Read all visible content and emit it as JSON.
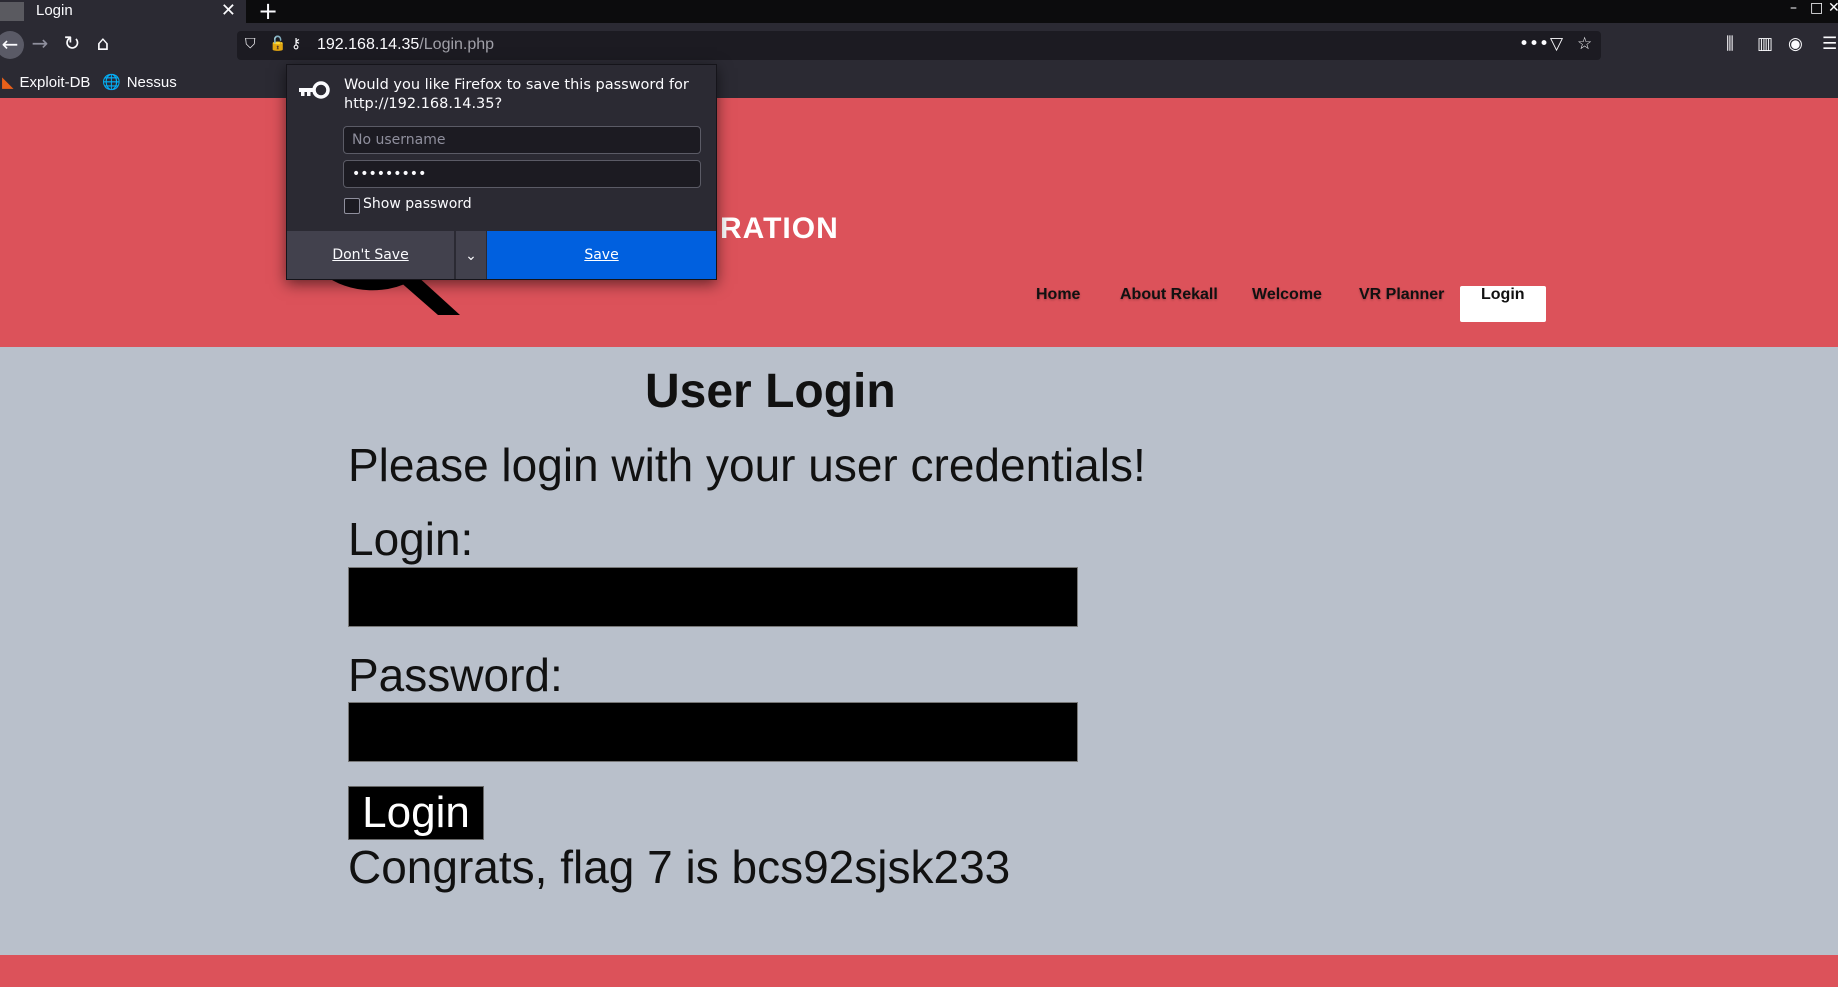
{
  "browser": {
    "tab_title": "Login",
    "url_host": "192.168.14.35",
    "url_path": "/Login.php",
    "bookmarks": [
      "Exploit-DB",
      "Nessus"
    ]
  },
  "password_prompt": {
    "message": "Would you like Firefox to save this password for http://192.168.14.35?",
    "username_placeholder": "No username",
    "password_value": "•••••••••",
    "show_password_label": "Show password",
    "dont_save_label": "Don't Save",
    "save_label": "Save"
  },
  "site": {
    "brand_visible": "RATION",
    "nav": [
      "Home",
      "About Rekall",
      "Welcome",
      "VR Planner",
      "Login"
    ],
    "active_nav": "Login"
  },
  "page": {
    "title": "User Login",
    "instruction": "Please login with your user credentials!",
    "login_label": "Login:",
    "password_label": "Password:",
    "login_button": "Login",
    "flag_message": "Congrats, flag 7 is bcs92sjsk233"
  },
  "colors": {
    "header_bg": "#dc525a",
    "page_bg": "#b9c0cb",
    "save_button": "#0060df"
  }
}
